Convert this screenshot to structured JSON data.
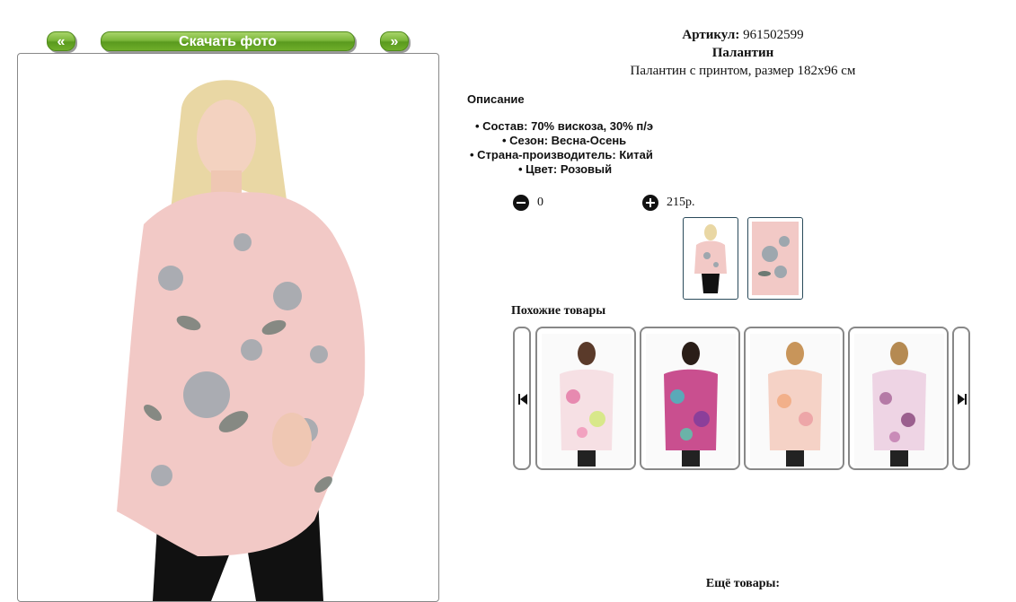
{
  "nav": {
    "prev_label": "«",
    "download_label": "Скачать фото",
    "next_label": "»"
  },
  "product": {
    "sku_label": "Артикул:",
    "sku": "961502599",
    "name": "Палантин",
    "subtitle": "Палантин с принтом, размер 182x96 см",
    "description_heading": "Описание",
    "specs": [
      "Состав: 70% вискоза, 30% п/э",
      "Сезон: Весна-Осень",
      "Страна-производитель: Китай",
      "Цвет: Розовый"
    ],
    "quantity": "0",
    "price": "215р."
  },
  "similar": {
    "heading": "Похожие товары"
  },
  "more": {
    "heading": "Ещё товары:"
  },
  "colors": {
    "button_green": "#7cb73b",
    "scarf_pink": "#f2c9c6",
    "frame_border": "#888888"
  }
}
